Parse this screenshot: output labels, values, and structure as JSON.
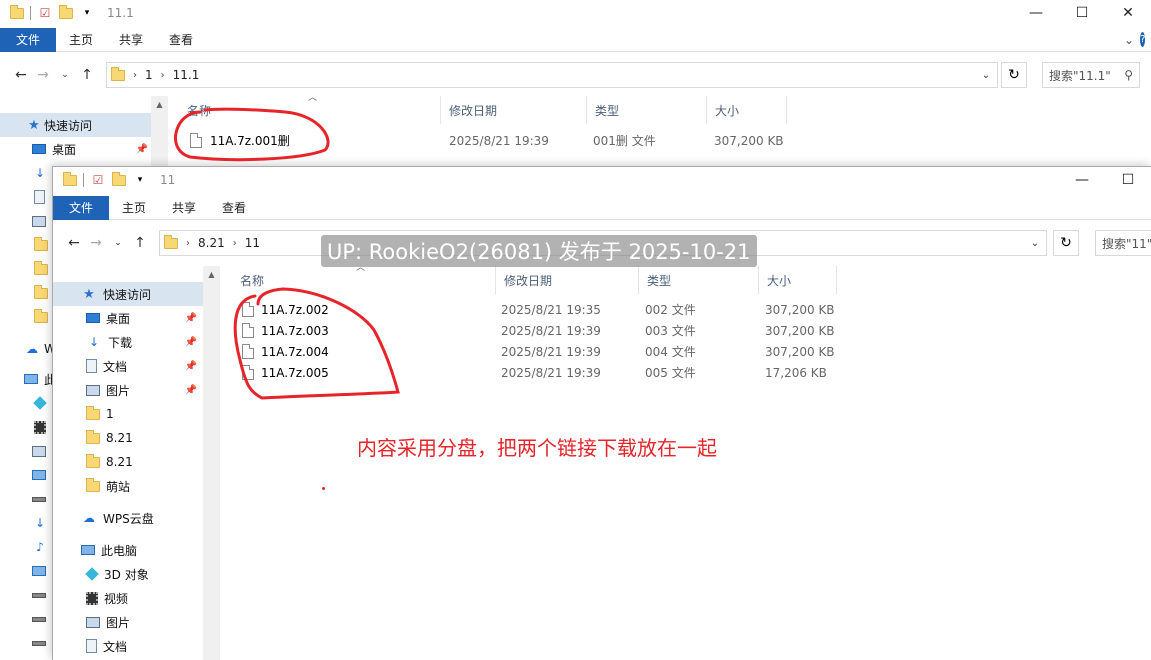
{
  "back_window": {
    "title": "11.1",
    "ribbon_tabs": [
      "文件",
      "主页",
      "共享",
      "查看"
    ],
    "path": [
      "1",
      "11.1"
    ],
    "search_placeholder": "搜索\"11.1\"",
    "columns": [
      "名称",
      "修改日期",
      "类型",
      "大小"
    ],
    "files": [
      {
        "name": "11A.7z.001删",
        "date": "2025/8/21 19:39",
        "type": "001删 文件",
        "size": "307,200 KB"
      }
    ],
    "nav": {
      "quick_access": "快速访问",
      "desktop": "桌面",
      "wps_partial": "W",
      "pc_partial": "此"
    }
  },
  "front_window": {
    "title": "11",
    "ribbon_tabs": [
      "文件",
      "主页",
      "共享",
      "查看"
    ],
    "path": [
      "8.21",
      "11"
    ],
    "search_placeholder": "搜索\"11\"",
    "columns": [
      "名称",
      "修改日期",
      "类型",
      "大小"
    ],
    "files": [
      {
        "name": "11A.7z.002",
        "date": "2025/8/21 19:35",
        "type": "002 文件",
        "size": "307,200 KB"
      },
      {
        "name": "11A.7z.003",
        "date": "2025/8/21 19:39",
        "type": "003 文件",
        "size": "307,200 KB"
      },
      {
        "name": "11A.7z.004",
        "date": "2025/8/21 19:39",
        "type": "004 文件",
        "size": "307,200 KB"
      },
      {
        "name": "11A.7z.005",
        "date": "2025/8/21 19:39",
        "type": "005 文件",
        "size": "17,206 KB"
      }
    ],
    "nav_items": [
      {
        "label": "快速访问",
        "icon": "star-icon"
      },
      {
        "label": "桌面",
        "icon": "desktop-icon",
        "pinned": true
      },
      {
        "label": "下载",
        "icon": "download-icon",
        "pinned": true
      },
      {
        "label": "文档",
        "icon": "document-icon",
        "pinned": true
      },
      {
        "label": "图片",
        "icon": "pictures-icon",
        "pinned": true
      },
      {
        "label": "1",
        "icon": "folder-icon"
      },
      {
        "label": "8.21",
        "icon": "folder-icon"
      },
      {
        "label": "8.21",
        "icon": "folder-icon"
      },
      {
        "label": "萌站",
        "icon": "folder-icon"
      },
      {
        "label": "WPS云盘",
        "icon": "cloud-icon"
      },
      {
        "label": "此电脑",
        "icon": "pc-icon"
      },
      {
        "label": "3D 对象",
        "icon": "3d-objects-icon"
      },
      {
        "label": "视频",
        "icon": "video-icon"
      },
      {
        "label": "图片",
        "icon": "pictures-icon"
      },
      {
        "label": "文档",
        "icon": "document-icon"
      }
    ]
  },
  "annotation": "内容采用分盘，把两个链接下载放在一起",
  "watermark": "UP: RookieO2(26081) 发布于 2025-10-21",
  "colors": {
    "ribbon_file": "#1e63b5",
    "annotation": "#e5252a",
    "nav_selected": "#d9e4f1"
  }
}
